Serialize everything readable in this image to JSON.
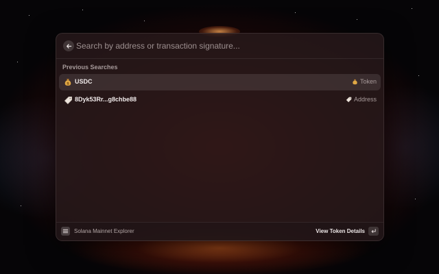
{
  "search": {
    "placeholder": "Search by address or transaction signature...",
    "back_icon": "arrow-left-icon"
  },
  "section": {
    "title": "Previous Searches"
  },
  "results": [
    {
      "title": "USDC",
      "icon": "money-bag-icon",
      "accessory_icon": "money-bag-icon",
      "accessory": "Token",
      "selected": true
    },
    {
      "title": "8Dyk53Rr...g8chbe88",
      "icon": "tag-icon",
      "accessory_icon": "tag-icon",
      "accessory": "Address",
      "selected": false
    }
  ],
  "footer": {
    "app_icon": "list-icon",
    "app_name": "Solana Mainnet Explorer",
    "primary_action": "View Token Details",
    "enter_icon": "return-key-icon"
  },
  "colors": {
    "panel_bg": "#26181a",
    "accent_gold": "#d9a441",
    "background": "#060507"
  }
}
